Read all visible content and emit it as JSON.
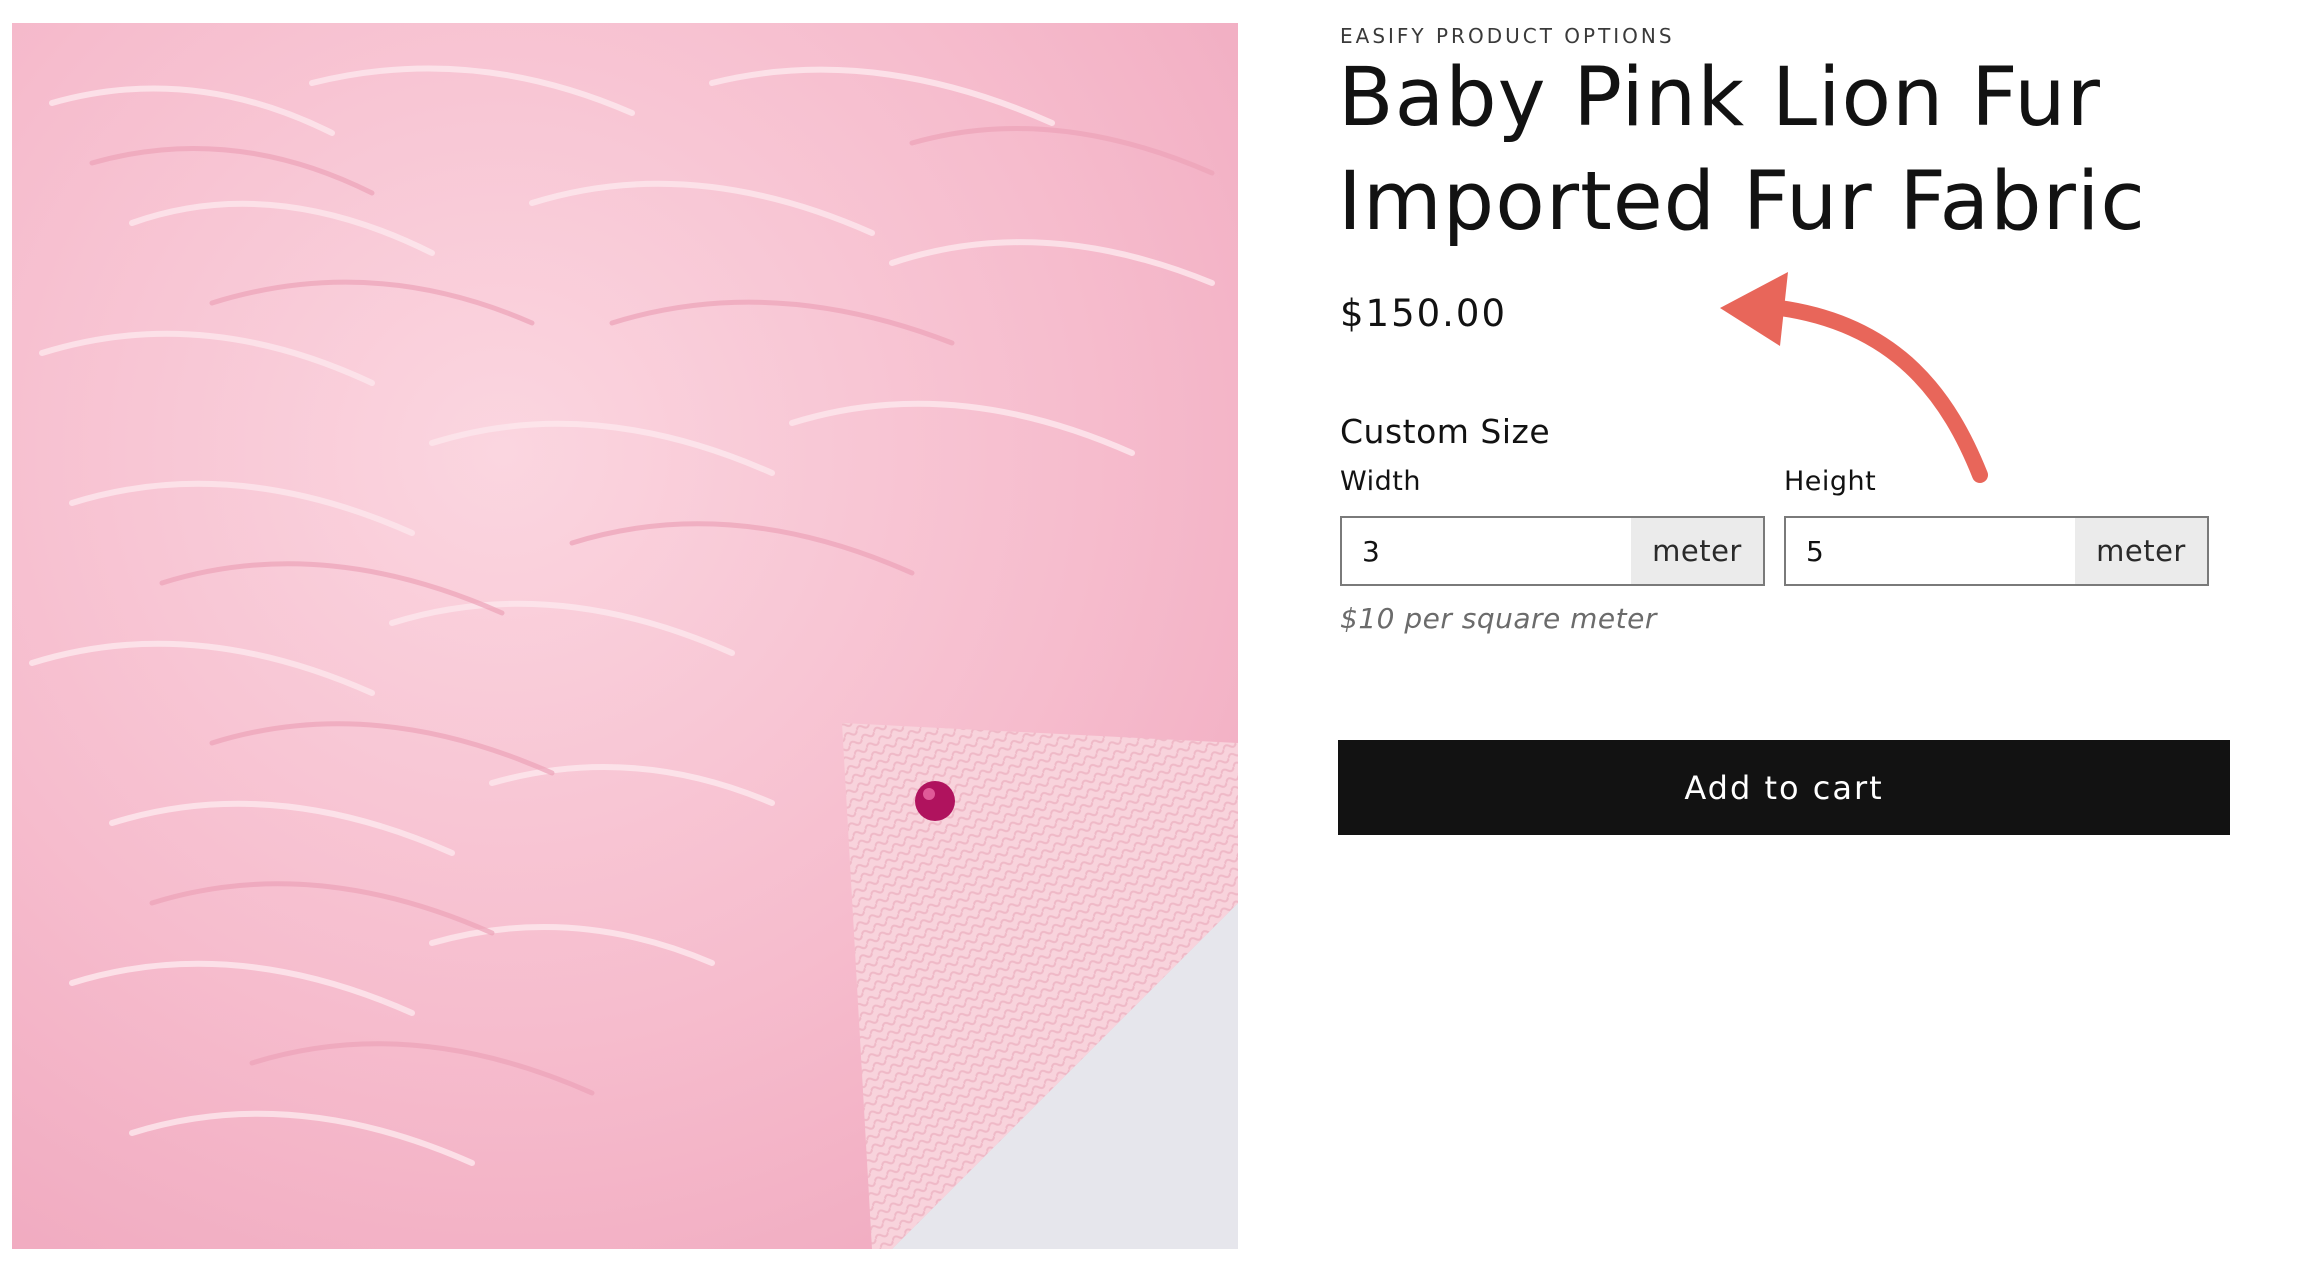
{
  "product": {
    "vendor": "EASIFY PRODUCT OPTIONS",
    "title_line_1": "Baby Pink Lion Fur",
    "title_line_2": "Imported Fur Fabric",
    "price": "$150.00",
    "image_description": "Baby pink long-pile faux fur fabric with folded corner showing knit backing and a magenta pin"
  },
  "custom_size": {
    "title": "Custom Size",
    "width": {
      "label": "Width",
      "value": "3",
      "unit": "meter"
    },
    "height": {
      "label": "Height",
      "value": "5",
      "unit": "meter"
    },
    "help_text": "$10 per square meter"
  },
  "actions": {
    "add_to_cart_label": "Add to cart"
  },
  "annotation": {
    "arrow_color": "#e8665a",
    "icon": "curved-arrow-icon"
  },
  "colors": {
    "button_bg": "#121212",
    "button_text": "#ffffff",
    "unit_bg": "#ebebeb",
    "fur_pink": "#f7c3d2"
  }
}
